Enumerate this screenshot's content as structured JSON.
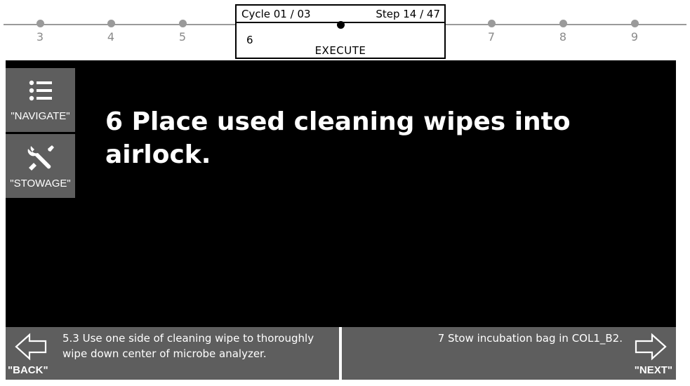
{
  "timeline": {
    "steps_before": [
      "3",
      "4",
      "5"
    ],
    "steps_after": [
      "7",
      "8",
      "9"
    ]
  },
  "current": {
    "cycle": "Cycle 01 / 03",
    "step": "Step 14 / 47",
    "number": "6",
    "mode": "EXECUTE"
  },
  "sidebar": {
    "navigate_label": "\"NAVIGATE\"",
    "navigate_icon": "list-icon",
    "stowage_label": "\"STOWAGE\"",
    "stowage_icon": "tools-icon"
  },
  "main": {
    "instruction": "6 Place used cleaning wipes into airlock."
  },
  "nav": {
    "back_label": "\"BACK\"",
    "back_text": "5.3 Use one side of cleaning wipe to thoroughly wipe down center of microbe analyzer.",
    "back_icon": "arrow-left-icon",
    "next_label": "\"NEXT\"",
    "next_text": "7 Stow incubation bag in COL1_B2.",
    "next_icon": "arrow-right-icon"
  },
  "colors": {
    "panel_gray": "#5e5e5e",
    "timeline_gray": "#9a9a9a",
    "main_background": "#000000",
    "text_white": "#ffffff"
  }
}
